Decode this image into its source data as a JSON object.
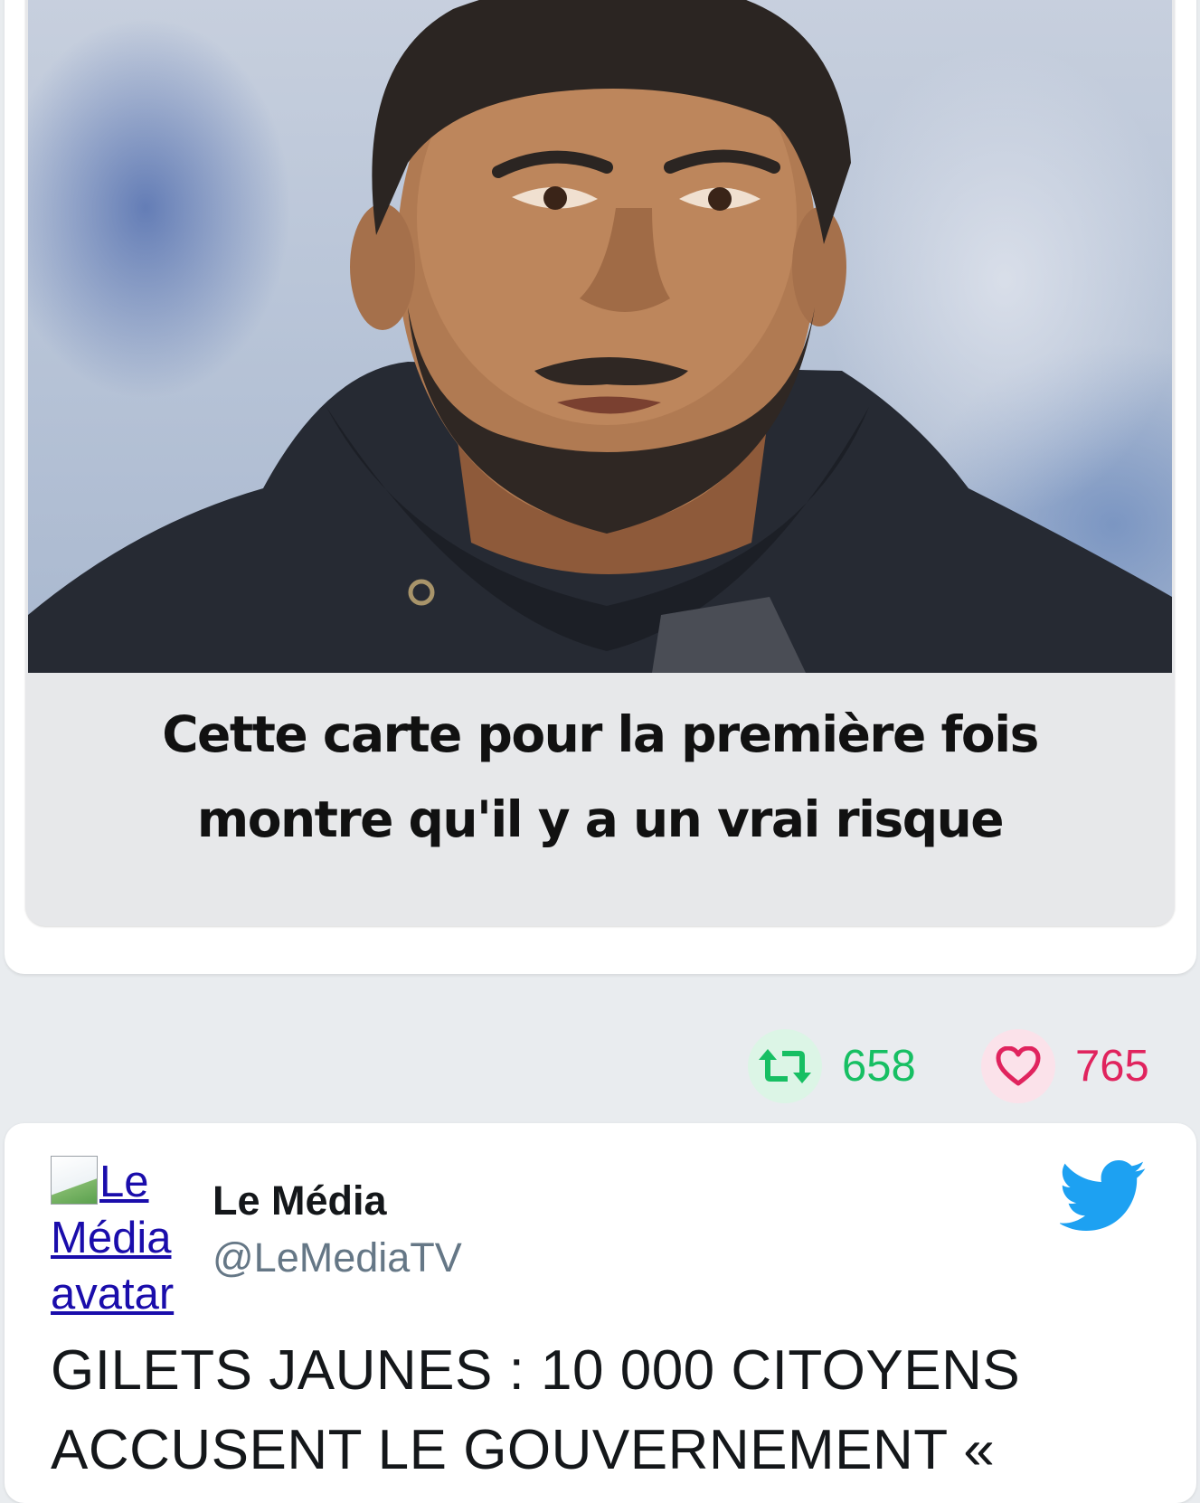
{
  "embedded_card": {
    "caption_line1": "Cette carte pour la première fois",
    "caption_line2": "montre qu'il y a un vrai risque"
  },
  "stats": {
    "retweet_icon": "retweet-icon",
    "retweet_count": "658",
    "like_icon": "heart-icon",
    "like_count": "765",
    "retweet_color": "#17bf63",
    "like_color": "#e0245e"
  },
  "tweet": {
    "avatar_alt": "Le Média avatar",
    "author_name": "Le Média",
    "author_handle": "@LeMediaTV",
    "brand_icon": "twitter-bird-icon",
    "brand_color": "#1da1f2",
    "text": "GILETS JAUNES : 10 000 CITOYENS ACCUSENT LE GOUVERNEMENT «"
  }
}
